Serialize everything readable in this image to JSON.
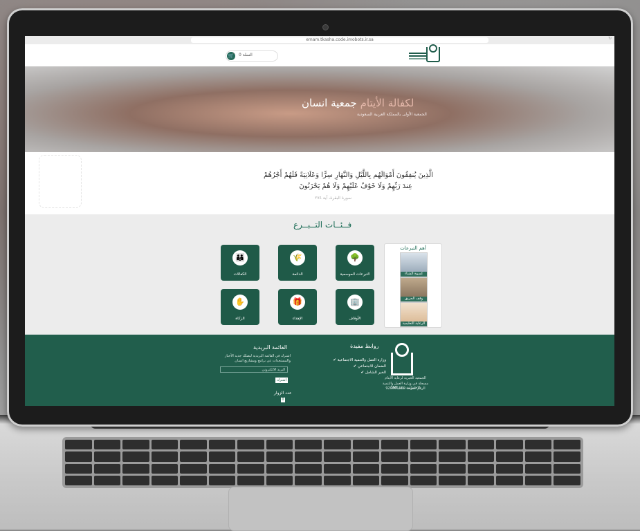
{
  "browser": {
    "url": "emam.tkasha.code.imobots.ir.sa"
  },
  "header": {
    "cart_label": "السلة 0"
  },
  "hero": {
    "title_main": "جمعية انسان",
    "title_accent": "لكفالة الأيتام",
    "subtitle": "الجمعية الأولى بالمملكة العربية السعودية"
  },
  "quote": {
    "line1": "الَّذِينَ يُنفِقُونَ أَمْوَالَهُم بِاللَّيْلِ وَالنَّهَارِ سِرًّا وَعَلَانِيَةً فَلَهُمْ أَجْرُهُمْ",
    "line2": "عِندَ رَبِّهِمْ وَلَا خَوْفٌ عَلَيْهِمْ وَلَا هُمْ يَحْزَنُونَ",
    "reference": "سورة البقرة، آية ٢٧٤"
  },
  "categories": {
    "title": "فــئــات التــبــرع",
    "tiles": [
      {
        "label": "الكفالات",
        "icon": "family-icon"
      },
      {
        "label": "الدائمة",
        "icon": "wheat-icon"
      },
      {
        "label": "التبرعات الموسمية",
        "icon": "tree-icon"
      },
      {
        "label": "الزكاة",
        "icon": "hand-coins-icon"
      },
      {
        "label": "الإهداء",
        "icon": "gift-icon"
      },
      {
        "label": "الأوقاف",
        "icon": "building-icon"
      }
    ]
  },
  "featured": {
    "title": "أهم التبرعات",
    "items": [
      {
        "label": "كسوة الشتاء"
      },
      {
        "label": "وقف الحريق"
      },
      {
        "label": "الرعاية التعليمية"
      }
    ]
  },
  "footer": {
    "logo_lines": [
      "الجمعية الخيرية لرعاية الأيتام",
      "مسجلة في وزارة العمل والتنمية الاجتماعية برقم 168",
      "الرقم الموحد 920001120"
    ],
    "links_title": "روابط مفيدة",
    "links": [
      "وزارة العمل والتنمية الاجتماعية",
      "الضمان الاجتماعي",
      "الخير الشامل"
    ],
    "newsletter_title": "القائمة البريدية",
    "newsletter_desc": "اشترك في القائمة البريدية ليصلك جديد الأخبار والمستجدات عن برامج ومشاريع انسان",
    "email_placeholder": "البريد الالكتروني",
    "subscribe_label": "اشترك",
    "visitors_title": "عدد الزوار",
    "visitors_count": "0"
  }
}
